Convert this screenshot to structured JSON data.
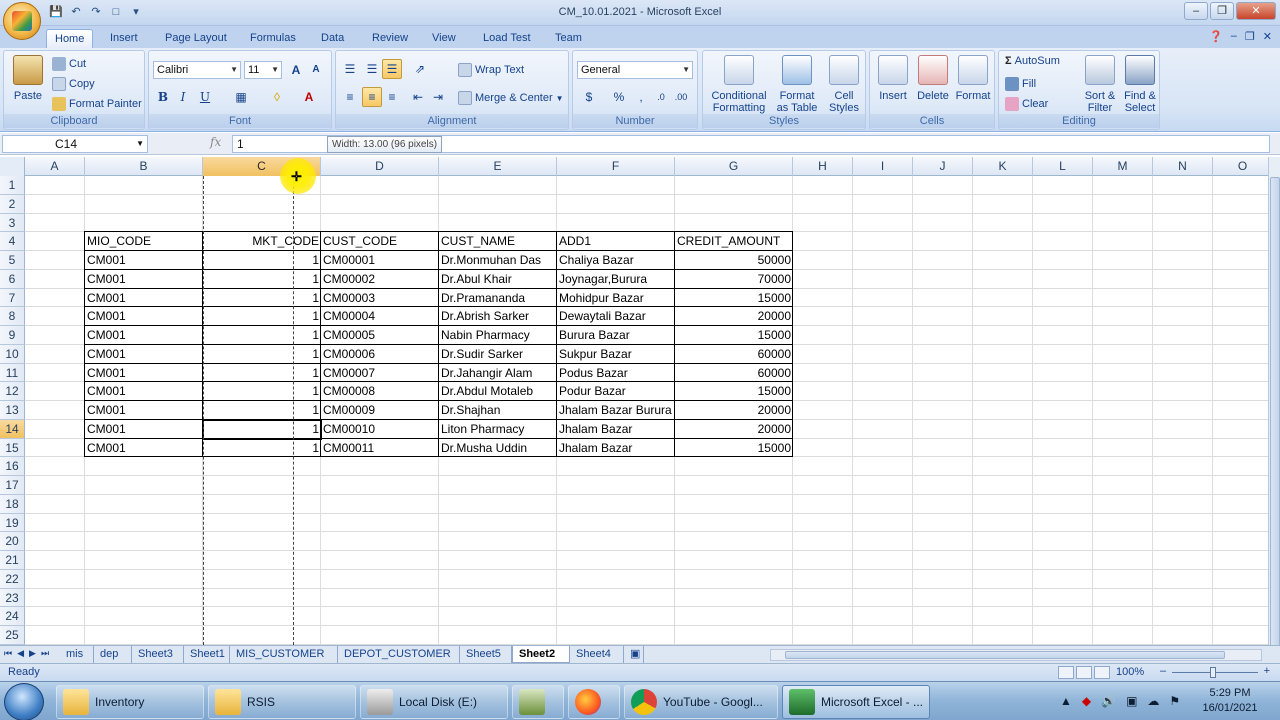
{
  "window": {
    "title": "CM_10.01.2021 - Microsoft Excel"
  },
  "ribbon_tabs": [
    "Home",
    "Insert",
    "Page Layout",
    "Formulas",
    "Data",
    "Review",
    "View",
    "Load Test",
    "Team"
  ],
  "ribbon": {
    "clipboard": {
      "paste": "Paste",
      "cut": "Cut",
      "copy": "Copy",
      "format_painter": "Format Painter",
      "label": "Clipboard"
    },
    "font": {
      "name": "Calibri",
      "size": "11",
      "label": "Font"
    },
    "alignment": {
      "wrap_text": "Wrap Text",
      "merge_center": "Merge & Center",
      "label": "Alignment"
    },
    "number": {
      "format": "General",
      "label": "Number"
    },
    "styles": {
      "conditional_formatting": "Conditional Formatting",
      "format_as_table": "Format as Table",
      "cell_styles": "Cell Styles",
      "label": "Styles"
    },
    "cells": {
      "insert": "Insert",
      "delete": "Delete",
      "format": "Format",
      "label": "Cells"
    },
    "editing": {
      "autosum": "AutoSum",
      "fill": "Fill",
      "clear": "Clear",
      "sort_filter": "Sort & Filter",
      "find_select": "Find & Select",
      "label": "Editing"
    }
  },
  "formula_bar": {
    "name_box": "C14",
    "fx": "fx",
    "value": "1",
    "tooltip": "Width: 13.00 (96 pixels)"
  },
  "columns": [
    "A",
    "B",
    "C",
    "D",
    "E",
    "F",
    "G",
    "H",
    "I",
    "J",
    "K",
    "L",
    "M",
    "N",
    "O"
  ],
  "rows": [
    "1",
    "2",
    "3",
    "4",
    "5",
    "6",
    "7",
    "8",
    "9",
    "10",
    "11",
    "12",
    "13",
    "14",
    "15",
    "16",
    "17",
    "18",
    "19",
    "20",
    "21",
    "22",
    "23",
    "24",
    "25"
  ],
  "table": {
    "headers": [
      "MIO_CODE",
      "MKT_CODE",
      "CUST_CODE",
      "CUST_NAME",
      "ADD1",
      "CREDIT_AMOUNT"
    ],
    "rows": [
      [
        "CM001",
        "1",
        "CM00001",
        "Dr.Monmuhan Das",
        "Chaliya Bazar",
        "50000"
      ],
      [
        "CM001",
        "1",
        "CM00002",
        "Dr.Abul Khair",
        "Joynagar,Burura",
        "70000"
      ],
      [
        "CM001",
        "1",
        "CM00003",
        "Dr.Pramananda",
        "Mohidpur Bazar",
        "15000"
      ],
      [
        "CM001",
        "1",
        "CM00004",
        "Dr.Abrish Sarker",
        "Dewaytali Bazar",
        "20000"
      ],
      [
        "CM001",
        "1",
        "CM00005",
        "Nabin Pharmacy",
        "Burura Bazar",
        "15000"
      ],
      [
        "CM001",
        "1",
        "CM00006",
        "Dr.Sudir Sarker",
        "Sukpur Bazar",
        "60000"
      ],
      [
        "CM001",
        "1",
        "CM00007",
        "Dr.Jahangir Alam",
        "Podus Bazar",
        "60000"
      ],
      [
        "CM001",
        "1",
        "CM00008",
        "Dr.Abdul Motaleb",
        "Podur Bazar",
        "15000"
      ],
      [
        "CM001",
        "1",
        "CM00009",
        "Dr.Shajhan",
        "Jhalam Bazar Burura",
        "20000"
      ],
      [
        "CM001",
        "1",
        "CM00010",
        "Liton Pharmacy",
        "Jhalam Bazar",
        "20000"
      ],
      [
        "CM001",
        "1",
        "CM00011",
        "Dr.Musha Uddin",
        "Jhalam Bazar",
        "15000"
      ]
    ]
  },
  "sheets": [
    "mis",
    "dep",
    "Sheet3",
    "Sheet1",
    "MIS_CUSTOMER",
    "DEPOT_CUSTOMER",
    "Sheet5",
    "Sheet2",
    "Sheet4"
  ],
  "active_sheet": "Sheet2",
  "status": {
    "text": "Ready",
    "zoom": "100%"
  },
  "taskbar": {
    "items": [
      "Inventory",
      "RSIS",
      "Local Disk (E:)",
      "",
      "",
      "YouTube - Googl...",
      "Microsoft Excel - ..."
    ],
    "time": "5:29 PM",
    "date": "16/01/2021"
  }
}
